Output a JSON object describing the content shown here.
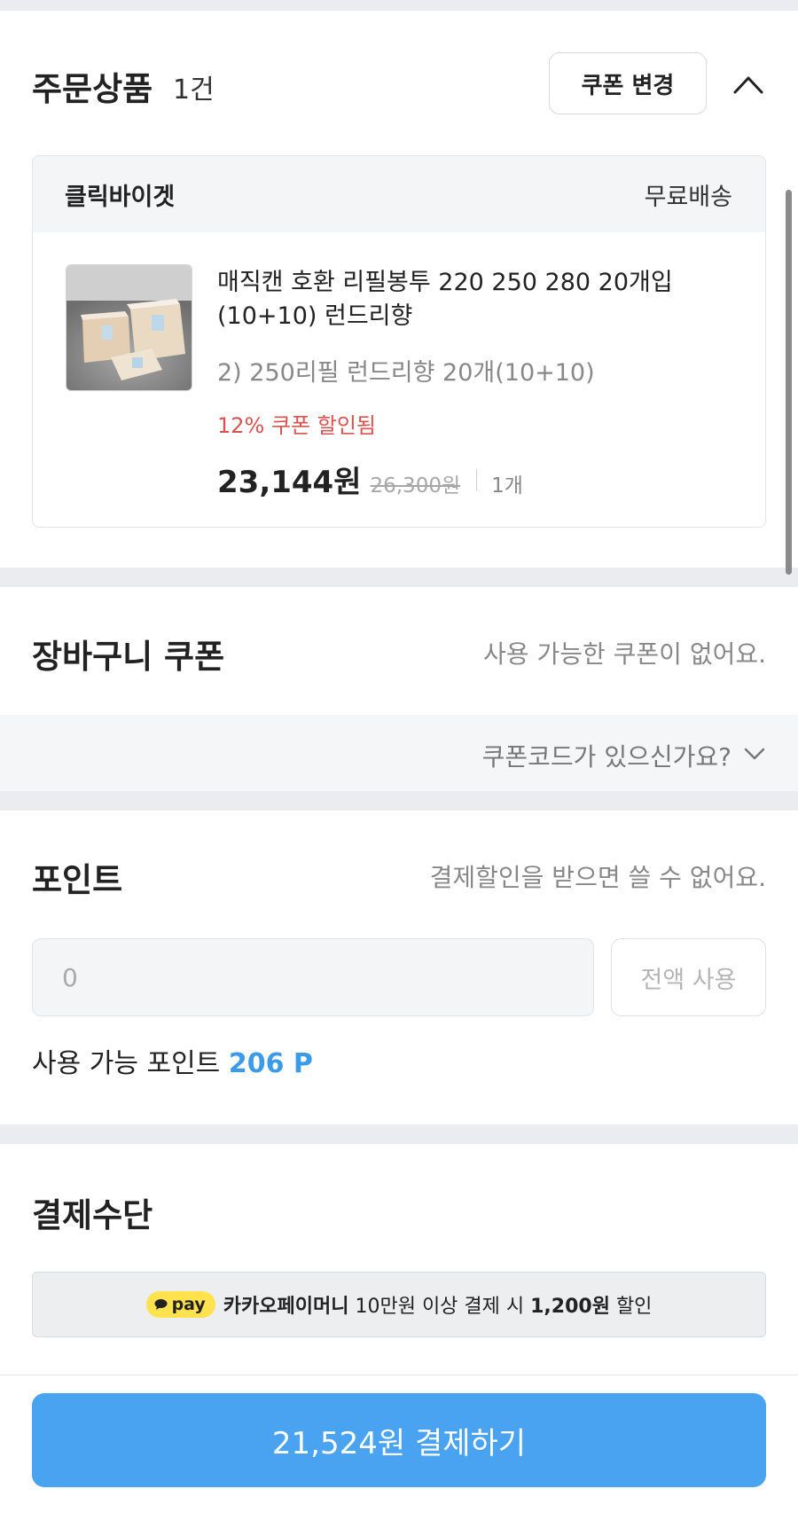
{
  "order": {
    "title": "주문상품",
    "count": "1건",
    "change_coupon_label": "쿠폰 변경",
    "collapse_icon": "chevron-up-icon",
    "seller": "클릭바이겟",
    "shipping": "무료배송",
    "product": {
      "name": "매직캔 호환 리필봉투 220 250 280 20개입 (10+10) 런드리향",
      "option": "2) 250리필 런드리향 20개(10+10)",
      "coupon_applied": "12% 쿠폰 할인됨",
      "price": "23,144원",
      "original_price": "26,300원",
      "quantity": "1개"
    }
  },
  "cart_coupon": {
    "title": "장바구니 쿠폰",
    "status": "사용 가능한 쿠폰이 없어요.",
    "code_prompt": "쿠폰코드가 있으신가요?",
    "code_icon": "chevron-down-icon"
  },
  "points": {
    "title": "포인트",
    "notice": "결제할인을 받으면 쓸 수 없어요.",
    "input_value": "0",
    "use_all_label": "전액 사용",
    "available_label": "사용 가능 포인트",
    "available_value": "206 P"
  },
  "payment": {
    "title": "결제수단",
    "kakaopay_badge": "pay",
    "banner_brand": "카카오페이머니",
    "banner_text_1": " 10만원 이상 결제 시 ",
    "banner_amount": "1,200원",
    "banner_text_2": " 할인"
  },
  "checkout": {
    "button_label": "21,524원 결제하기"
  },
  "colors": {
    "accent": "#4aa3f0",
    "points_blue": "#3c9be8",
    "coupon_red": "#d9534f",
    "kakao_yellow": "#ffe24d",
    "section_gap": "#eaecef"
  }
}
